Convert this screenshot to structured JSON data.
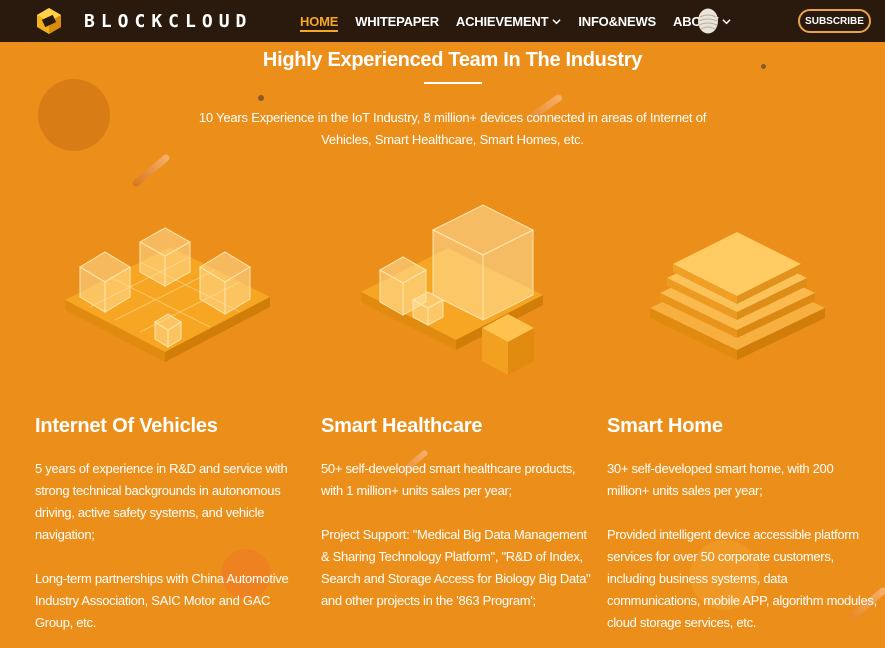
{
  "brand": {
    "name": "BLOCKCLOUD"
  },
  "nav": {
    "items": [
      {
        "label": "HOME",
        "active": true
      },
      {
        "label": "WHITEPAPER"
      },
      {
        "label": "ACHIEVEMENT",
        "dropdown": true
      },
      {
        "label": "INFO&NEWS"
      },
      {
        "label": "ABOUT",
        "dropdown": true
      }
    ],
    "subscribe_label": "SUBSCRIBE"
  },
  "section": {
    "title": "Highly Experienced Team In The Industry",
    "subtitle": "10 Years Experience in the IoT Industry, 8 million+ devices connected in areas of Internet of Vehicles, Smart Healthcare, Smart Homes, etc."
  },
  "columns": [
    {
      "title": "Internet Of Vehicles",
      "paragraphs": [
        "5 years of experience in R&D and service with strong technical backgrounds in autonomous driving, active safety systems, and vehicle navigation;",
        "Long-term partnerships with China Automotive Industry Association, SAIC Motor and GAC Group, etc."
      ]
    },
    {
      "title": "Smart Healthcare",
      "paragraphs": [
        "50+ self-developed smart healthcare products, with 1 million+ units sales per year;",
        "Project Support: \"Medical Big Data Management & Sharing Technology Platform\", \"R&D of Index, Search and Storage Access for Biology Big Data\" and other projects in the '863 Program';"
      ]
    },
    {
      "title": "Smart Home",
      "paragraphs": [
        "30+ self-developed smart home, with 200 million+ units sales per year;",
        "Provided intelligent device accessible platform services for over 50 corporate customers, including business systems, data communications, mobile APP, algorithm modules, cloud storage services, etc."
      ]
    }
  ],
  "colors": {
    "background": "#EC8F1A",
    "topbar": "#2A1A0E",
    "accent": "#F5A623"
  },
  "icons": [
    "blockcloud-logo-icon",
    "chevron-down-icon",
    "egg-icon",
    "cubes-grid-illustration",
    "cubes-stack-illustration",
    "layers-illustration"
  ]
}
